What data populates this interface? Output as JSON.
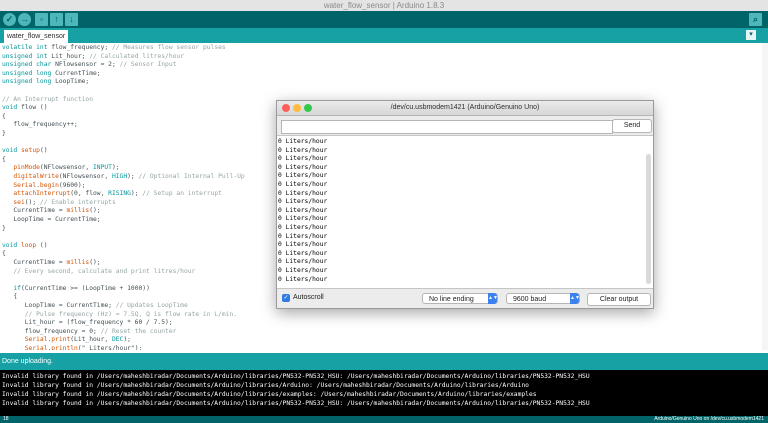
{
  "window": {
    "title": "water_flow_sensor | Arduino 1.8.3"
  },
  "toolbar": {
    "buttons": [
      "verify-icon",
      "upload-icon",
      "new-icon",
      "open-icon",
      "save-icon",
      "serial-monitor-icon"
    ],
    "accent": "#006468"
  },
  "tab": {
    "label": "water_flow_sensor"
  },
  "code_lines": [
    [
      [
        "kw",
        "volatile"
      ],
      [
        "t",
        " "
      ],
      [
        "kw",
        "int"
      ],
      [
        "t",
        " flow_frequency; "
      ],
      [
        "cm",
        "// Measures flow sensor pulses"
      ]
    ],
    [
      [
        "kw",
        "unsigned"
      ],
      [
        "t",
        " "
      ],
      [
        "kw",
        "int"
      ],
      [
        "t",
        " Lit_hour; "
      ],
      [
        "cm",
        "// Calculated litres/hour"
      ]
    ],
    [
      [
        "kw",
        "unsigned"
      ],
      [
        "t",
        " "
      ],
      [
        "kw",
        "char"
      ],
      [
        "t",
        " "
      ],
      [
        "t",
        "NFlowsensor = 2; "
      ],
      [
        "cm",
        "// Sensor Input"
      ]
    ],
    [
      [
        "kw",
        "unsigned"
      ],
      [
        "t",
        " "
      ],
      [
        "kw",
        "long"
      ],
      [
        "t",
        " CurrentTime;"
      ]
    ],
    [
      [
        "kw",
        "unsigned"
      ],
      [
        "t",
        " "
      ],
      [
        "kw",
        "long"
      ],
      [
        "t",
        " LoopTime;"
      ]
    ],
    [
      [
        "t",
        ""
      ]
    ],
    [
      [
        "cm",
        "// An Interrupt function"
      ]
    ],
    [
      [
        "kw",
        "void"
      ],
      [
        "t",
        " flow ()"
      ]
    ],
    [
      [
        "t",
        "{"
      ]
    ],
    [
      [
        "t",
        "   flow_frequency++;"
      ]
    ],
    [
      [
        "t",
        "}"
      ]
    ],
    [
      [
        "t",
        ""
      ]
    ],
    [
      [
        "kw",
        "void"
      ],
      [
        "t",
        " "
      ],
      [
        "fn",
        "setup"
      ],
      [
        "t",
        "()"
      ]
    ],
    [
      [
        "t",
        "{"
      ]
    ],
    [
      [
        "t",
        "   "
      ],
      [
        "fn",
        "pinMode"
      ],
      [
        "t",
        "(NFlowsensor, "
      ],
      [
        "kw",
        "INPUT"
      ],
      [
        "t",
        ");"
      ]
    ],
    [
      [
        "t",
        "   "
      ],
      [
        "fn",
        "digitalWrite"
      ],
      [
        "t",
        "(NFlowsensor, "
      ],
      [
        "kw",
        "HIGH"
      ],
      [
        "t",
        "); "
      ],
      [
        "cm",
        "// Optional Internal Pull-Up"
      ]
    ],
    [
      [
        "t",
        "   "
      ],
      [
        "fn",
        "Serial"
      ],
      [
        "t",
        "."
      ],
      [
        "fn",
        "begin"
      ],
      [
        "t",
        "(9600);"
      ]
    ],
    [
      [
        "t",
        "   "
      ],
      [
        "fn",
        "attachInterrupt"
      ],
      [
        "t",
        "(0, flow, "
      ],
      [
        "kw",
        "RISING"
      ],
      [
        "t",
        "); "
      ],
      [
        "cm",
        "// Setup an interrupt"
      ]
    ],
    [
      [
        "t",
        "   "
      ],
      [
        "fn",
        "sei"
      ],
      [
        "t",
        "(); "
      ],
      [
        "cm",
        "// Enable interrupts"
      ]
    ],
    [
      [
        "t",
        "   CurrentTime = "
      ],
      [
        "fn",
        "millis"
      ],
      [
        "t",
        "();"
      ]
    ],
    [
      [
        "t",
        "   LoopTime = CurrentTime;"
      ]
    ],
    [
      [
        "t",
        "}"
      ]
    ],
    [
      [
        "t",
        ""
      ]
    ],
    [
      [
        "kw",
        "void"
      ],
      [
        "t",
        " "
      ],
      [
        "fn",
        "loop"
      ],
      [
        "t",
        " ()"
      ]
    ],
    [
      [
        "t",
        "{"
      ]
    ],
    [
      [
        "t",
        "   CurrentTime = "
      ],
      [
        "fn",
        "millis"
      ],
      [
        "t",
        "();"
      ]
    ],
    [
      [
        "t",
        "   "
      ],
      [
        "cm",
        "// Every second, calculate and print litres/hour"
      ]
    ],
    [
      [
        "t",
        ""
      ]
    ],
    [
      [
        "t",
        "   "
      ],
      [
        "kw",
        "if"
      ],
      [
        "t",
        "(CurrentTime >= (LoopTime + 1000))"
      ]
    ],
    [
      [
        "t",
        "   {"
      ]
    ],
    [
      [
        "t",
        "      LoopTime = CurrentTime; "
      ],
      [
        "cm",
        "// Updates LoopTime"
      ]
    ],
    [
      [
        "t",
        "      "
      ],
      [
        "cm",
        "// Pulse frequency (Hz) = 7.5Q, Q is flow rate in L/min."
      ]
    ],
    [
      [
        "t",
        "      Lit_hour = (flow_frequency * 60 / 7.5);"
      ]
    ],
    [
      [
        "t",
        "      flow_frequency = 0; "
      ],
      [
        "cm",
        "// Reset the counter"
      ]
    ],
    [
      [
        "t",
        "      "
      ],
      [
        "fn",
        "Serial"
      ],
      [
        "t",
        "."
      ],
      [
        "fn",
        "print"
      ],
      [
        "t",
        "(Lit_hour, "
      ],
      [
        "kw",
        "DEC"
      ],
      [
        "t",
        ");"
      ]
    ],
    [
      [
        "t",
        "      "
      ],
      [
        "fn",
        "Serial"
      ],
      [
        "t",
        "."
      ],
      [
        "fn",
        "println"
      ],
      [
        "t",
        "(\" Liters/hour\");"
      ]
    ]
  ],
  "serial_monitor": {
    "title": "/dev/cu.usbmodem1421 (Arduino/Genuino Uno)",
    "send_label": "Send",
    "input_value": "",
    "output_lines": [
      "0 Liters/hour",
      "0 Liters/hour",
      "0 Liters/hour",
      "0 Liters/hour",
      "0 Liters/hour",
      "0 Liters/hour",
      "0 Liters/hour",
      "0 Liters/hour",
      "0 Liters/hour",
      "0 Liters/hour",
      "0 Liters/hour",
      "0 Liters/hour",
      "0 Liters/hour",
      "0 Liters/hour",
      "0 Liters/hour",
      "0 Liters/hour",
      "0 Liters/hour"
    ],
    "autoscroll_label": "Autoscroll",
    "autoscroll_checked": true,
    "line_ending": "No line ending",
    "baud": "9600 baud",
    "clear_label": "Clear output"
  },
  "status": {
    "message": "Done uploading."
  },
  "console_lines": [
    "Invalid library found in /Users/maheshbiradar/Documents/Arduino/libraries/PN532-PN532_HSU: /Users/maheshbiradar/Documents/Arduino/libraries/PN532-PN532_HSU",
    "Invalid library found in /Users/maheshbiradar/Documents/Arduino/libraries/Arduino: /Users/maheshbiradar/Documents/Arduino/libraries/Arduino",
    "Invalid library found in /Users/maheshbiradar/Documents/Arduino/libraries/examples: /Users/maheshbiradar/Documents/Arduino/libraries/examples",
    "Invalid library found in /Users/maheshbiradar/Documents/Arduino/libraries/PN532-PN532_HSU: /Users/maheshbiradar/Documents/Arduino/libraries/PN532-PN532_HSU"
  ],
  "footer": {
    "line_number": "18",
    "board": "Arduino/Genuino Uno on /dev/cu.usbmodem1421"
  }
}
